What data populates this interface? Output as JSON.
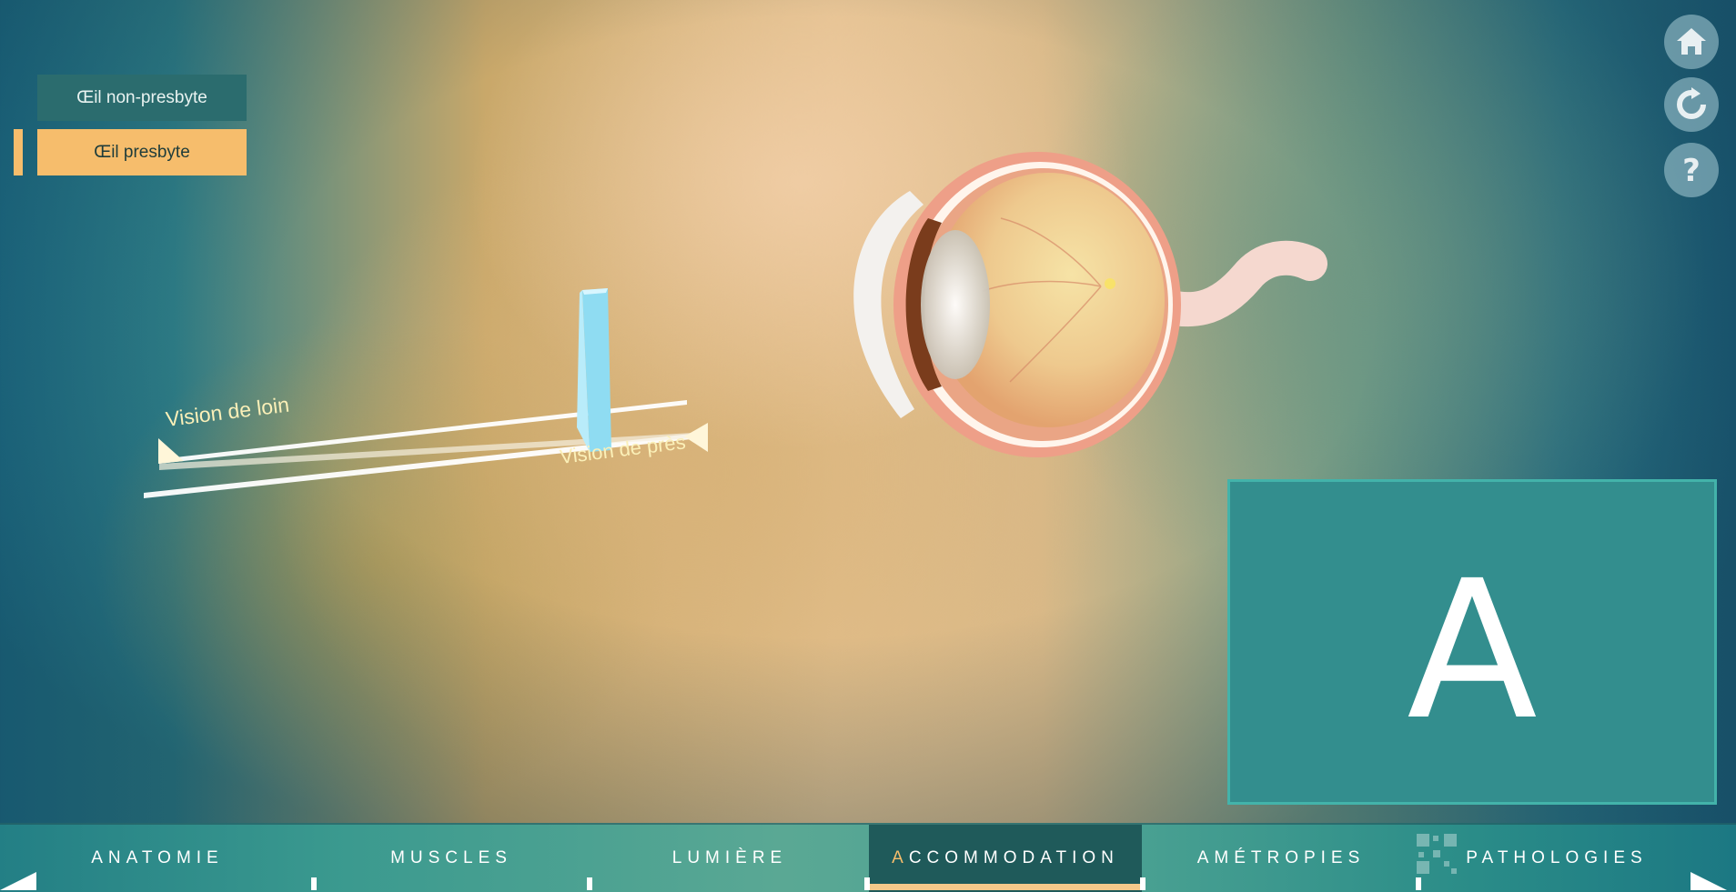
{
  "modes": {
    "non_presbyte": "Œil non-presbyte",
    "presbyte": "Œil presbyte",
    "selected": "Œil presbyte"
  },
  "vision_slider": {
    "far_label": "Vision de loin",
    "near_label": "Vision de près"
  },
  "letter_panel": {
    "letter": "A"
  },
  "side_icons": [
    "home-icon",
    "reset-icon",
    "help-icon"
  ],
  "nav": {
    "items": [
      {
        "label": "ANATOMIE"
      },
      {
        "label": "MUSCLES"
      },
      {
        "label": "LUMIÈRE"
      },
      {
        "label_first": "A",
        "label_rest": "CCOMMODATION"
      },
      {
        "label": "AMÉTROPIES"
      },
      {
        "label": "PATHOLOGIES"
      }
    ],
    "active": "ACCOMMODATION"
  },
  "colors": {
    "accent_orange": "#f6bd6c",
    "teal_dark": "#2b6c6e",
    "panel_teal": "#338e8e",
    "slider_marker": "#8fdcf2"
  }
}
